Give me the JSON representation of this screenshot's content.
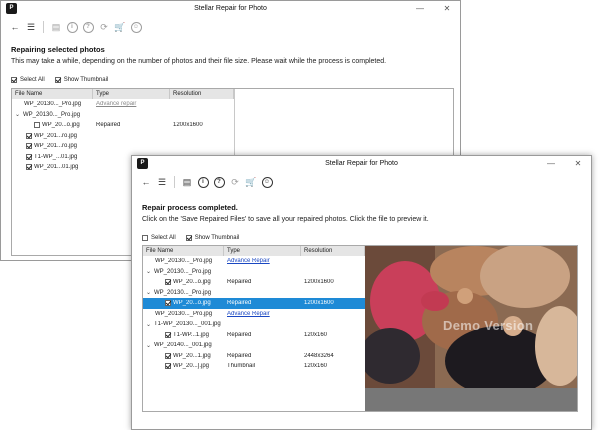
{
  "back_window": {
    "title": "Stellar Repair for Photo",
    "heading": "Repairing selected photos",
    "message": "This may take a while, depending on the number of photos and their file size. Please wait while the process is completed.",
    "select_all": "Select All",
    "show_thumbnail": "Show Thumbnail",
    "columns": [
      "File Name",
      "Type",
      "Resolution"
    ],
    "rows": [
      {
        "name": "WP_20130..._Pro.jpg",
        "type": "Advance repair",
        "resolution": ""
      },
      {
        "name": "WP_20130..._Pro.jpg",
        "type": "",
        "resolution": ""
      },
      {
        "name": "WP_20...o.jpg",
        "type": "Repaired",
        "resolution": "1200x1600"
      },
      {
        "name": "WP_201...ro.jpg",
        "type": "",
        "resolution": ""
      },
      {
        "name": "WP_201...ro.jpg",
        "type": "",
        "resolution": ""
      },
      {
        "name": "T1-WP_...01.jpg",
        "type": "",
        "resolution": ""
      },
      {
        "name": "WP_201...01.jpg",
        "type": "",
        "resolution": ""
      }
    ]
  },
  "front_window": {
    "title": "Stellar Repair for Photo",
    "heading": "Repair process completed.",
    "message": "Click on the 'Save Repaired Files' to save all your repaired photos. Click the file to preview it.",
    "select_all": "Select All",
    "show_thumbnail": "Show Thumbnail",
    "columns": [
      "File Name",
      "Type",
      "Resolution"
    ],
    "rows": [
      {
        "name": "WP_20130..._Pro.jpg",
        "type": "Advance Repair",
        "resolution": ""
      },
      {
        "name": "WP_20130..._Pro.jpg",
        "type": "",
        "resolution": ""
      },
      {
        "name": "WP_20...o.jpg",
        "type": "Repaired",
        "resolution": "1200x1600"
      },
      {
        "name": "WP_20130..._Pro.jpg",
        "type": "",
        "resolution": ""
      },
      {
        "name": "WP_20...o.jpg",
        "type": "Repaired",
        "resolution": "1200x1600"
      },
      {
        "name": "WP_20130..._Pro.jpg",
        "type": "Advance Repair",
        "resolution": ""
      },
      {
        "name": "T1-WP_20130..._001.jpg",
        "type": "",
        "resolution": ""
      },
      {
        "name": "T1-WP...1.jpg",
        "type": "Repaired",
        "resolution": "120x160"
      },
      {
        "name": "WP_20140..._001.jpg",
        "type": "",
        "resolution": ""
      },
      {
        "name": "WP_20...1.jpg",
        "type": "Repaired",
        "resolution": "2448x3264"
      },
      {
        "name": "WP_20...].jpg",
        "type": "Thumbnail",
        "resolution": "120x160"
      }
    ],
    "watermark": "Demo Version"
  },
  "colors": {
    "selection": "#1e8ad6",
    "link": "#1a47c2"
  }
}
